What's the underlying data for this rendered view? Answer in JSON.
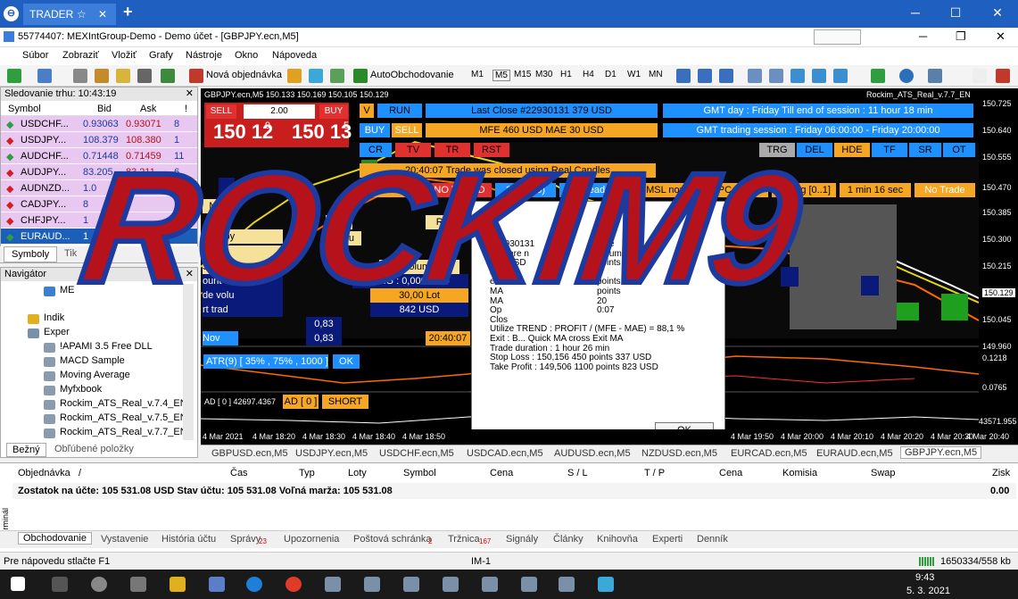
{
  "tabbar": {
    "tab": "TRADER",
    "star": "☆",
    "close": "✕",
    "plus": "+",
    "min": "─",
    "max": "☐",
    "winclose": "✕"
  },
  "mdi": {
    "title": "55774407: MEXIntGroup-Demo - Demo účet - [GBPJPY.ecn,M5]",
    "min": "─",
    "restore": "❐",
    "close": "✕"
  },
  "menu": [
    "Súbor",
    "Zobraziť",
    "Vložiť",
    "Grafy",
    "Nástroje",
    "Okno",
    "Nápoveda"
  ],
  "toolbar": {
    "new_order": "Nová objednávka",
    "autotrading": "AutoObchodovanie",
    "timeframes": [
      "M1",
      "M5",
      "M15",
      "M30",
      "H1",
      "H4",
      "D1",
      "W1",
      "MN"
    ]
  },
  "market_watch": {
    "title": "Sledovanie trhu: 10:43:19",
    "columns": [
      "Symbol",
      "Bid",
      "Ask",
      "!"
    ],
    "rows": [
      {
        "symbol": "USDCHF...",
        "bid": "0.93063",
        "ask": "0.93071",
        "spread": "8",
        "dir": "up"
      },
      {
        "symbol": "USDJPY...",
        "bid": "108.379",
        "ask": "108.380",
        "spread": "1",
        "dir": "down"
      },
      {
        "symbol": "AUDCHF...",
        "bid": "0.71448",
        "ask": "0.71459",
        "spread": "11",
        "dir": "up"
      },
      {
        "symbol": "AUDJPY...",
        "bid": "83.205",
        "ask": "83.211",
        "spread": "6",
        "dir": "down"
      },
      {
        "symbol": "AUDNZD...",
        "bid": "1.0",
        "ask": "",
        "spread": "",
        "dir": "down"
      },
      {
        "symbol": "CADJPY...",
        "bid": "8",
        "ask": "",
        "spread": "",
        "dir": "down"
      },
      {
        "symbol": "CHFJPY...",
        "bid": "1",
        "ask": "",
        "spread": "",
        "dir": "down"
      },
      {
        "symbol": "EURAUD...",
        "bid": "1",
        "ask": "",
        "spread": "",
        "dir": "up"
      }
    ],
    "tabs": [
      "Symboly",
      "Tik"
    ]
  },
  "navigator": {
    "title": "Navigátor",
    "items": [
      "ME",
      "Indik",
      "Exper",
      "!APAMI 3.5 Free DLL",
      "MACD Sample",
      "Moving Average",
      "Myfxbook",
      "Rockim_ATS_Real_v.7.4_EN",
      "Rockim_ATS_Real_v.7.5_EN",
      "Rockim_ATS_Real_v.7.7_EN"
    ],
    "tabs": [
      "Bežný",
      "Obľúbené položky"
    ]
  },
  "chart": {
    "header": "GBPJPY.ecn,M5  150.133 150.169 150.105 150.129",
    "ea": "Rockim_ATS_Real_v.7.7_EN",
    "sell": "SELL",
    "buy": "BUY",
    "lot": "2.00",
    "bid_big": "150 12",
    "bid_sup": "9",
    "ask_big": "150 13",
    "ask_sup": "5",
    "v": "V",
    "run": "RUN",
    "last_close": "Last Close  #22930131   379 USD",
    "gmt": "GMT day : Friday      Till end of session : 11 hour 18 min",
    "buy2": "BUY",
    "sell2": "SELL",
    "mfe": "MFE 460 USD  MAE 30 USD",
    "session": "GMT trading session : Friday 06:00:00 - Friday 20:00:00",
    "cr": "CR",
    "tv": "TV",
    "tr": "TR",
    "rst": "RST",
    "tail": [
      "TRG",
      "DEL",
      "HDE",
      "TF",
      "SR",
      "OT"
    ],
    "closed": "20:40:07  Trade was closed using Real Candles",
    "status": [
      "No Trade",
      "NO TREND",
      "28 (26.0)",
      "Spread : 7",
      "MSL none",
      "iPC none",
      "Strong [0..1]",
      "1 min 16 sec",
      "No Trade"
    ],
    "atr": "ATR(9) [ 35% , 75% , 1000 ]",
    "atr_ok": "OK",
    "ad": "AD [ 0 ] 42697.4367",
    "ad_badge": "AD [ 0 ]",
    "short": "SHORT",
    "price_tag": "150.129",
    "prices": [
      "150.725",
      "150.640",
      "150.555",
      "150.470",
      "150.385",
      "150.300",
      "150.215",
      "150.129",
      "150.045",
      "149.960",
      "0.1218",
      "0.0765",
      "43571.955"
    ],
    "times": [
      "4 Mar 2021",
      "4 Mar 18:20",
      "4 Mar 18:30",
      "4 Mar 18:40",
      "4 Mar 18:50",
      "4 Mar 19:50",
      "4 Mar 20:00",
      "4 Mar 20:10",
      "4 Mar 20:20",
      "4 Mar 20:30",
      "4 Mar 20:40"
    ],
    "bg_labels": [
      "Mo",
      "rting by",
      "charts",
      "Sum S",
      "ount",
      "de volu",
      "rt trad",
      "Nov",
      "lex",
      "Nu",
      "RG",
      "Volume",
      "ORG : 0,000 USD",
      "30,00 Lot",
      "842 USD",
      "0,83",
      "0,83",
      "20:40:07"
    ]
  },
  "dialog": {
    "lines": [
      "#22930131",
      "nals are n",
      "379 USD",
      "count",
      "ex",
      "MA",
      "MA",
      "Op",
      "Clos",
      "Utilize TREND :  PROFIT / (MFE - MAE) = 88,1 %",
      "Exit :  B... Quick MA cross Exit MA",
      "Trade duration :  1 hour 26 min",
      "Stop Loss :  150,156   450 points  337 USD",
      "Take Profit :  149,506   1100 points  823 USD"
    ],
    "right": [
      "mbe",
      "Volum",
      "points",
      "t",
      "points",
      "points",
      "20",
      "0:07",
      "",
      "",
      "",
      "",
      "",
      ""
    ],
    "ok": "OK"
  },
  "chart_tabs": [
    "GBPUSD.ecn,M5",
    "USDJPY.ecn,M5",
    "USDCHF.ecn,M5",
    "USDCAD.ecn,M5",
    "AUDUSD.ecn,M5",
    "NZDUSD.ecn,M5",
    "EURCAD.ecn,M5",
    "EURAUD.ecn,M5",
    "GBPJPY.ecn,M5"
  ],
  "terminal": {
    "columns": [
      "Objednávka",
      "/",
      "Čas",
      "Typ",
      "Loty",
      "Symbol",
      "Cena",
      "S / L",
      "T / P",
      "Cena",
      "Komisia",
      "Swap",
      "Zisk"
    ],
    "balance": "Zostatok na účte: 105 531.08 USD  Stav účtu: 105 531.08  Voľná marža: 105 531.08",
    "profit": "0.00",
    "side": "Terminál",
    "tabs": [
      "Obchodovanie",
      "Vystavenie",
      "História účtu",
      "Správy",
      "Upozornenia",
      "Poštová schránka",
      "Tržnica",
      "Signály",
      "Články",
      "Knihovňa",
      "Experti",
      "Denník"
    ],
    "badges": {
      "Správy": "23",
      "Poštová schránka": "2",
      "Tržnica": "167"
    }
  },
  "statusbar": {
    "help": "Pre nápovedu stlačte F1",
    "im": "IM-1",
    "traffic": "1650334/558 kb"
  },
  "taskbar": {
    "time": "9:43",
    "date": "5. 3. 2021"
  },
  "watermark": "ROCKIM9",
  "colors": {
    "titlebar": "#1f5fbf",
    "watermark_fill": "#b5121b",
    "watermark_stroke": "#1c3aa0",
    "panel_blue": "#1e90ff",
    "panel_orange": "#f5a623",
    "panel_red": "#e02020"
  }
}
